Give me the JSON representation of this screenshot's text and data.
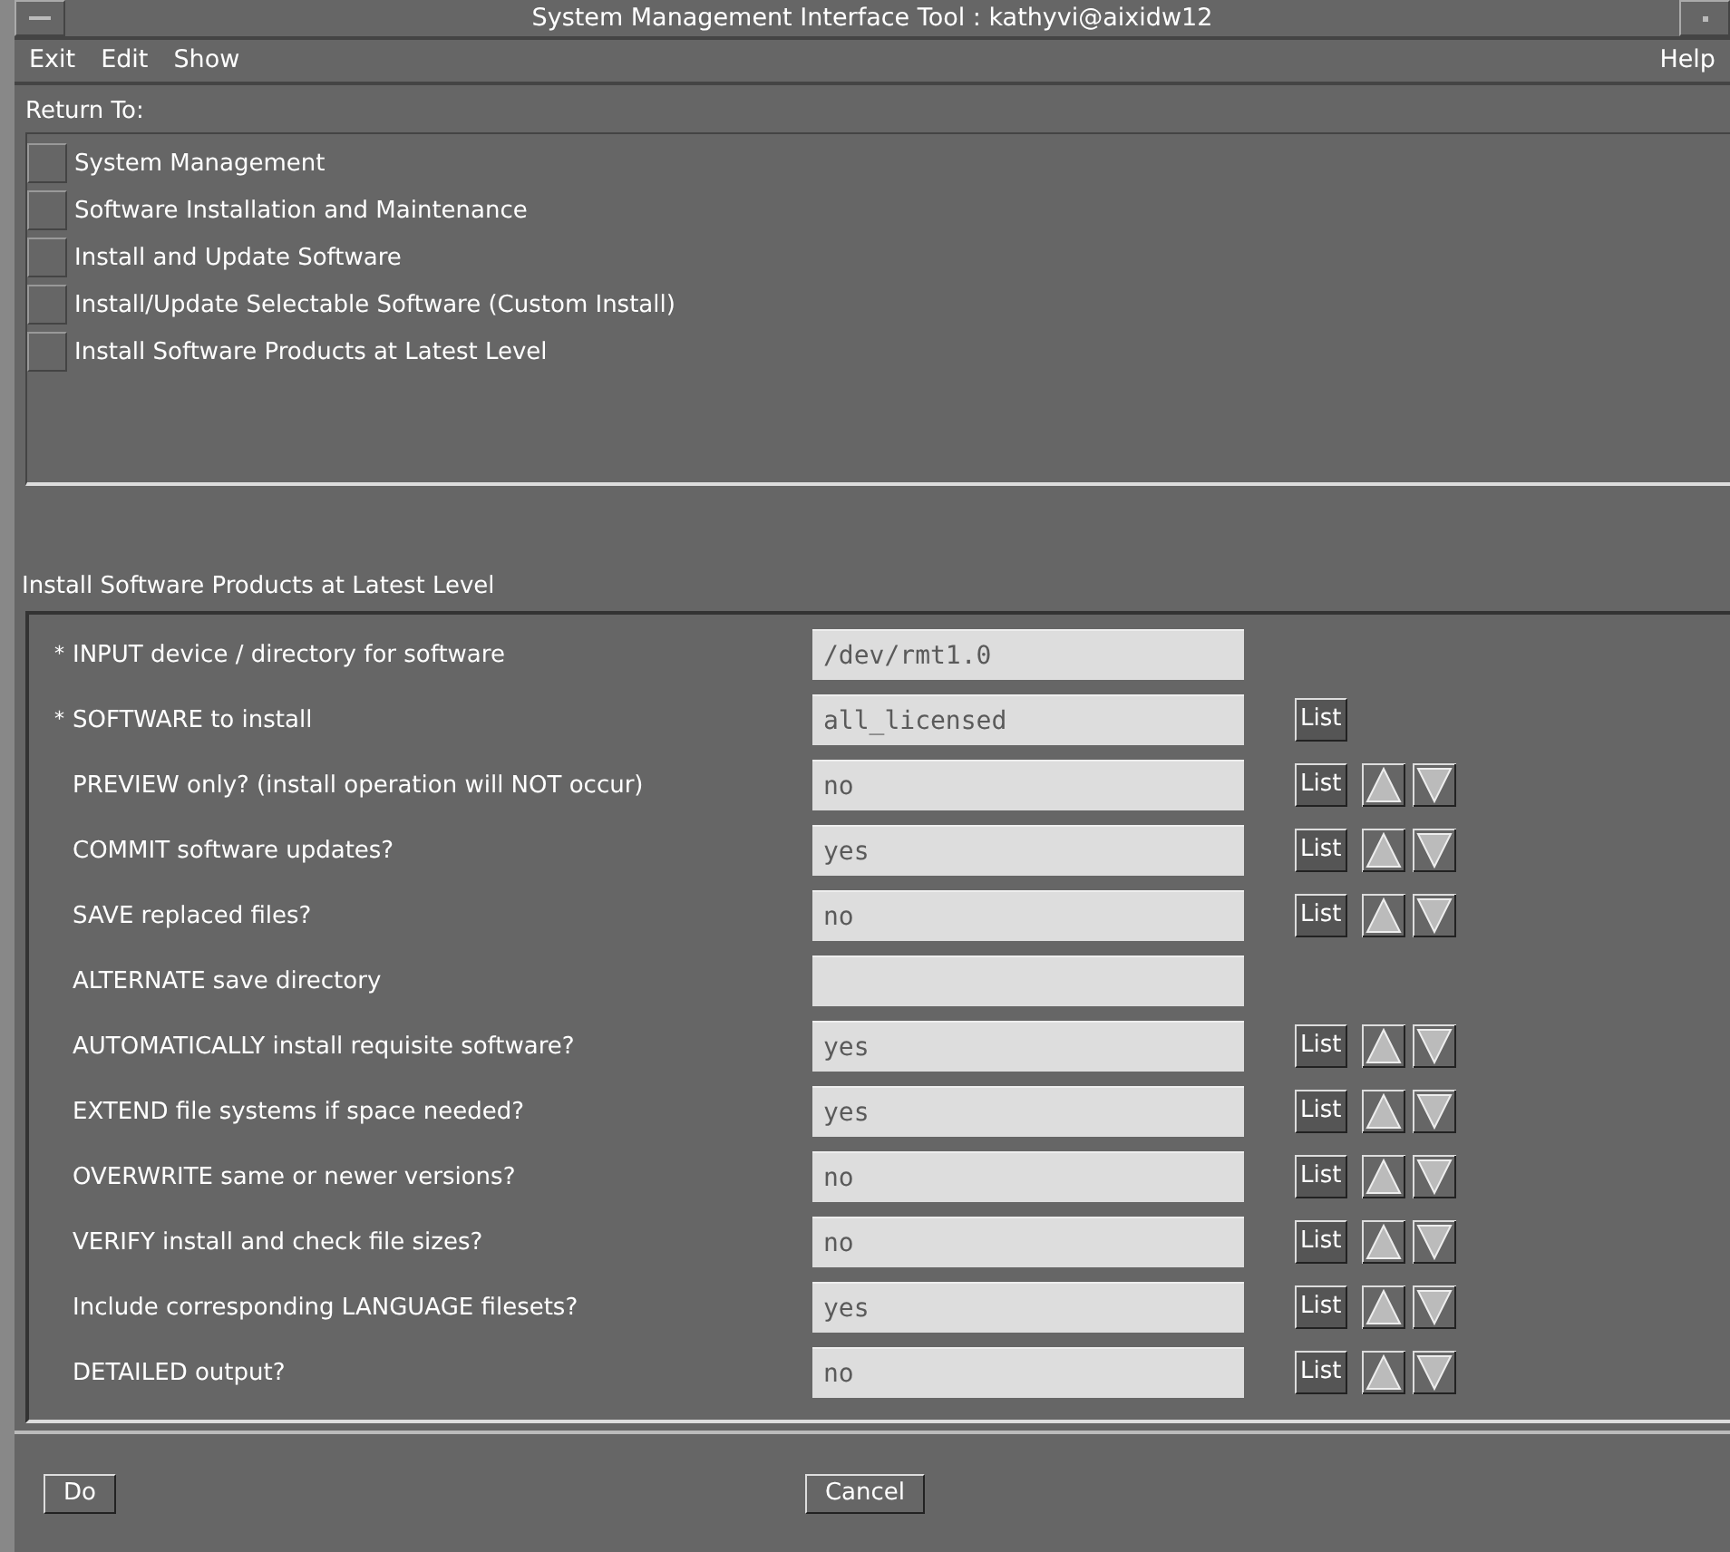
{
  "window": {
    "title": "System Management Interface Tool : kathyvi@aixidw12"
  },
  "menu": [
    {
      "label": "Exit"
    },
    {
      "label": "Edit"
    },
    {
      "label": "Show"
    }
  ],
  "help_menu": {
    "label": "Help"
  },
  "return_to": {
    "title": "Return To:",
    "items": [
      {
        "label": "System Management"
      },
      {
        "label": "Software Installation and Maintenance"
      },
      {
        "label": "Install and Update Software"
      },
      {
        "label": "Install/Update Selectable Software (Custom Install)"
      },
      {
        "label": "Install Software Products at Latest Level"
      }
    ]
  },
  "form": {
    "title": "Install Software Products at Latest Level",
    "rows": [
      {
        "marker": "*",
        "label": "INPUT device / directory for software",
        "value": "/dev/rmt1.0",
        "spinner": false
      },
      {
        "marker": "*",
        "label": "SOFTWARE to install",
        "value": "all_licensed",
        "list_label": "List",
        "spinner": false
      },
      {
        "label": "PREVIEW only? (install operation will NOT occur)",
        "value": "no",
        "list_label": "List",
        "spinner": true
      },
      {
        "label": "COMMIT software updates?",
        "value": "yes",
        "list_label": "List",
        "spinner": true
      },
      {
        "label": "SAVE replaced files?",
        "value": "no",
        "list_label": "List",
        "spinner": true
      },
      {
        "label": "ALTERNATE save directory",
        "spinner": false
      },
      {
        "label": "AUTOMATICALLY install requisite software?",
        "value": "yes",
        "list_label": "List",
        "spinner": true
      },
      {
        "label": "EXTEND file systems if space needed?",
        "value": "yes",
        "list_label": "List",
        "spinner": true
      },
      {
        "label": "OVERWRITE same or newer versions?",
        "value": "no",
        "list_label": "List",
        "spinner": true
      },
      {
        "label": "VERIFY install and check file sizes?",
        "value": "no",
        "list_label": "List",
        "spinner": true
      },
      {
        "label": "Include corresponding LANGUAGE filesets?",
        "value": "yes",
        "list_label": "List",
        "spinner": true
      },
      {
        "label": "DETAILED output?",
        "value": "no",
        "list_label": "List",
        "spinner": true
      }
    ]
  },
  "buttons": [
    {
      "label": "Do"
    },
    {
      "label": "Cancel"
    }
  ]
}
